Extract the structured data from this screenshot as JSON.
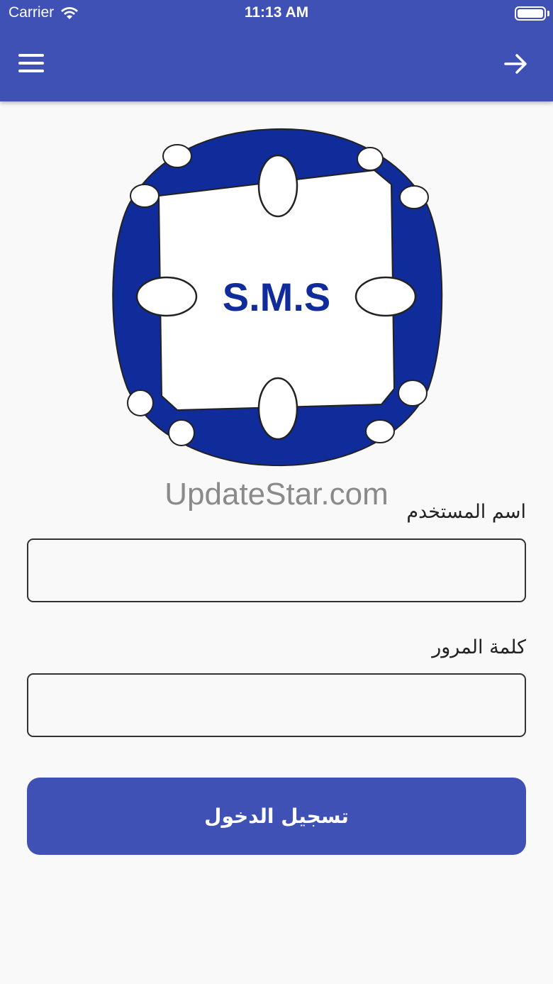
{
  "status_bar": {
    "carrier": "Carrier",
    "time": "11:13 AM"
  },
  "header": {
    "menu_icon": "hamburger-menu-icon",
    "back_icon": "arrow-right-icon"
  },
  "logo": {
    "text": "S.M.S",
    "color": "#102b9a"
  },
  "watermark": "UpdateStar.com",
  "form": {
    "username_label": "اسم المستخدم",
    "username_value": "",
    "password_label": "كلمة المرور",
    "password_value": "",
    "login_label": "تسجيل الدخول"
  },
  "colors": {
    "primary": "#3f51b5",
    "background": "#f9f9f9"
  }
}
